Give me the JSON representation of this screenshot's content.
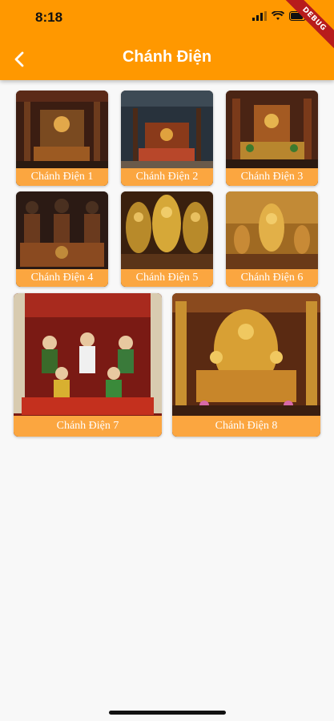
{
  "status": {
    "time": "8:18"
  },
  "debug_banner": "DEBUG",
  "header": {
    "title": "Chánh Điện"
  },
  "tiles": [
    {
      "label": "Chánh Điện 1"
    },
    {
      "label": "Chánh Điện 2"
    },
    {
      "label": "Chánh Điện 3"
    },
    {
      "label": "Chánh Điện 4"
    },
    {
      "label": "Chánh Điện 5"
    },
    {
      "label": "Chánh Điện 6"
    },
    {
      "label": "Chánh Điện 7"
    },
    {
      "label": "Chánh Điện 8"
    }
  ],
  "colors": {
    "appbar": "#ff9800",
    "caption": "#fba640",
    "background": "#f8f8f8"
  }
}
